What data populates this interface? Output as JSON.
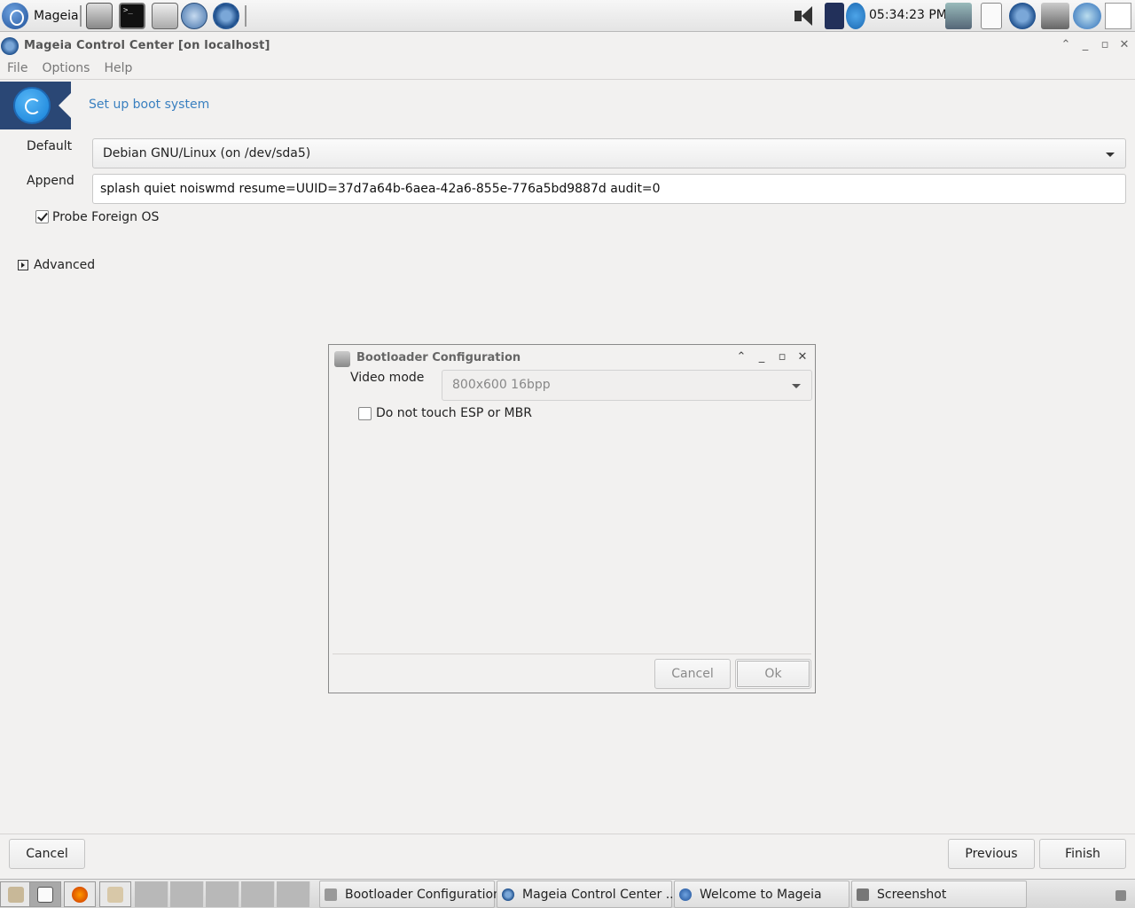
{
  "top_panel": {
    "menu_label": "Mageia",
    "clock": "05:34:23 PM",
    "launchers": [
      "file-manager-icon",
      "terminal-icon",
      "file-cabinet-icon",
      "web-browser-icon",
      "control-center-icon"
    ],
    "tray": [
      "volume-icon",
      "vpn-lock-icon",
      "network-icon",
      "monitor-icon",
      "usb-device-icon",
      "update-applet-icon",
      "screenshot-icon",
      "thunderbird-icon",
      "text-editor-icon"
    ]
  },
  "window": {
    "title": "Mageia Control Center  [on localhost]",
    "menu": [
      "File",
      "Options",
      "Help"
    ],
    "header_title": "Set up boot system"
  },
  "form": {
    "default_label": "Default",
    "default_value": "Debian GNU/Linux (on /dev/sda5)",
    "append_label": "Append",
    "append_value": "splash quiet noiswmd resume=UUID=37d7a64b-6aea-42a6-855e-776a5bd9887d audit=0",
    "probe_label": "Probe Foreign OS",
    "probe_checked": true,
    "advanced_label": "Advanced"
  },
  "dialog": {
    "title": "Bootloader Configuration",
    "video_mode_label": "Video mode",
    "video_mode_value": "800x600 16bpp",
    "esp_label": "Do not touch ESP or MBR",
    "esp_checked": false,
    "cancel_label": "Cancel",
    "ok_label": "Ok"
  },
  "footer": {
    "cancel_label": "Cancel",
    "previous_label": "Previous",
    "finish_label": "Finish"
  },
  "taskbar": {
    "tasks": [
      {
        "label": "Bootloader Configuration",
        "icon": "bootloader-icon"
      },
      {
        "label": "Mageia Control Center  ...",
        "icon": "control-center-icon"
      },
      {
        "label": "Welcome to Mageia",
        "icon": "welcome-icon"
      },
      {
        "label": "Screenshot",
        "icon": "screenshot-icon"
      }
    ]
  }
}
